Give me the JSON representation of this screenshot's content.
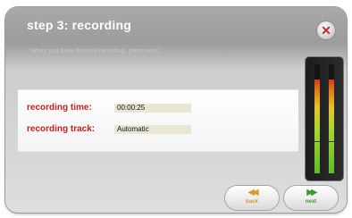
{
  "dialog": {
    "title": "step 3: recording",
    "close_icon": "close-icon",
    "instruction_text": "When you have finished recording, press ",
    "instruction_emphasis": "next."
  },
  "form": {
    "recording_time_label": "recording time:",
    "recording_time_value": "00:00:25",
    "recording_track_label": "recording track:",
    "recording_track_value": "Automatic"
  },
  "level_meter": {
    "left_level": 0.86,
    "right_level": 0.86,
    "colors": {
      "top": "#d43a17",
      "mid": "#e3c52a",
      "bottom": "#5fbd2a"
    }
  },
  "navigation": {
    "back": {
      "label": "back",
      "icon": "rewind-icon",
      "color": "#d89a2a"
    },
    "next": {
      "label": "next",
      "icon": "fast-forward-icon",
      "color": "#3a9a2c"
    }
  }
}
